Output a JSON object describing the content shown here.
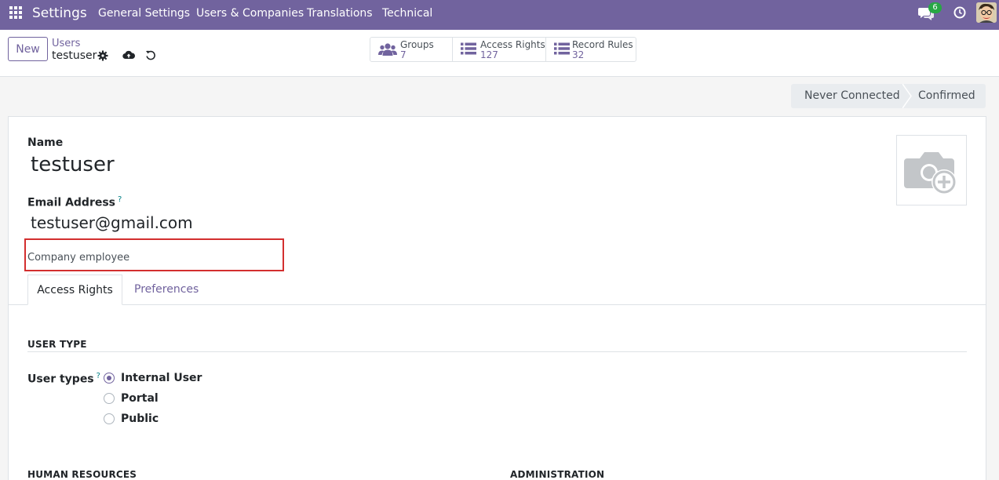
{
  "navbar": {
    "brand": "Settings",
    "menu": [
      "General Settings",
      "Users & Companies",
      "Translations",
      "Technical"
    ],
    "chat_badge": "6",
    "icons": [
      "apps-grid-icon",
      "chat-icon",
      "clock-icon",
      "user-avatar"
    ]
  },
  "control_panel": {
    "new_label": "New",
    "breadcrumb_parent": "Users",
    "breadcrumb_current": "testuser",
    "icons": [
      "gear-icon",
      "cloud-upload-icon",
      "undo-icon"
    ],
    "stats": [
      {
        "label": "Groups",
        "value": "7",
        "icon": "users-icon"
      },
      {
        "label": "Access Rights",
        "value": "127",
        "icon": "list-icon"
      },
      {
        "label": "Record Rules",
        "value": "32",
        "icon": "list-icon"
      }
    ]
  },
  "status": {
    "steps": [
      "Never Connected",
      "Confirmed"
    ]
  },
  "form": {
    "name_label": "Name",
    "name_value": "testuser",
    "email_label": "Email Address",
    "help_mark": "?",
    "email_value": "testuser@gmail.com",
    "company_text": "Company employee",
    "tabs": [
      "Access Rights",
      "Preferences"
    ],
    "user_type_title": "USER TYPE",
    "user_types_label": "User types",
    "user_types": [
      {
        "label": "Internal User",
        "checked": true
      },
      {
        "label": "Portal",
        "checked": false
      },
      {
        "label": "Public",
        "checked": false
      }
    ],
    "hr_title": "HUMAN RESOURCES",
    "admin_title": "ADMINISTRATION"
  },
  "colors": {
    "brand": "#71639e",
    "badge": "#28a745",
    "highlight": "#d32f2f"
  }
}
